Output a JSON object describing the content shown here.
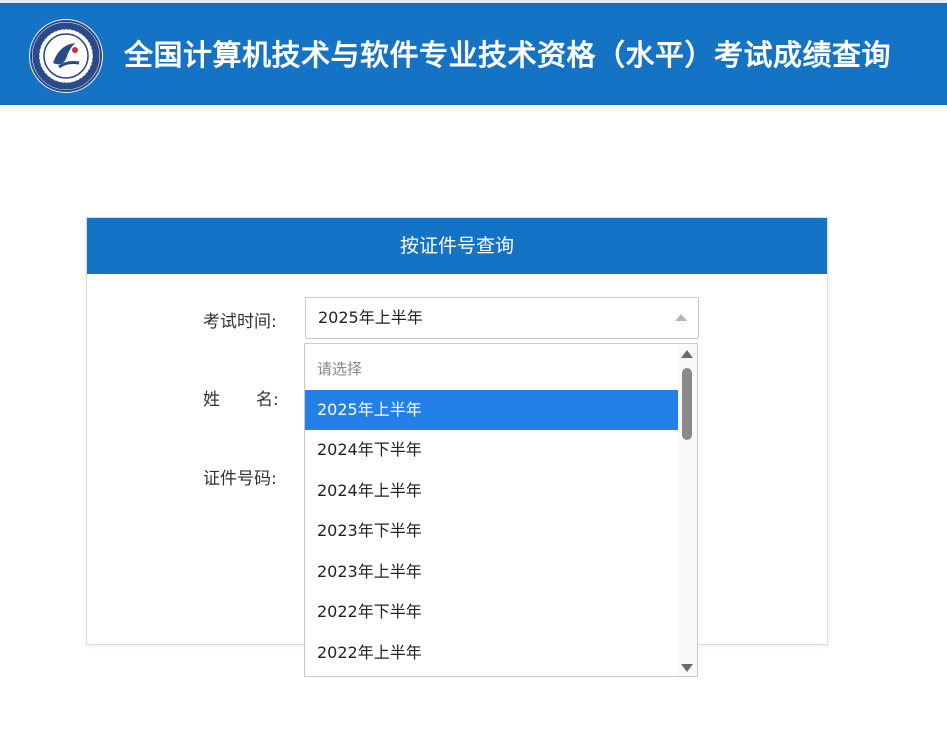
{
  "header": {
    "title": "全国计算机技术与软件专业技术资格（水平）考试成绩查询",
    "background_color": "#1573c5"
  },
  "panel": {
    "title": "按证件号查询"
  },
  "form": {
    "exam_time_label": "考试时间:",
    "name_label_first": "姓",
    "name_label_second": "名:",
    "id_label": "证件号码:",
    "exam_time_value": "2025年上半年"
  },
  "dropdown": {
    "placeholder": "请选择",
    "options": [
      "2025年上半年",
      "2024年下半年",
      "2024年上半年",
      "2023年下半年",
      "2023年上半年",
      "2022年下半年",
      "2022年上半年"
    ],
    "selected_index": 0,
    "selected_color": "#2280e8"
  }
}
